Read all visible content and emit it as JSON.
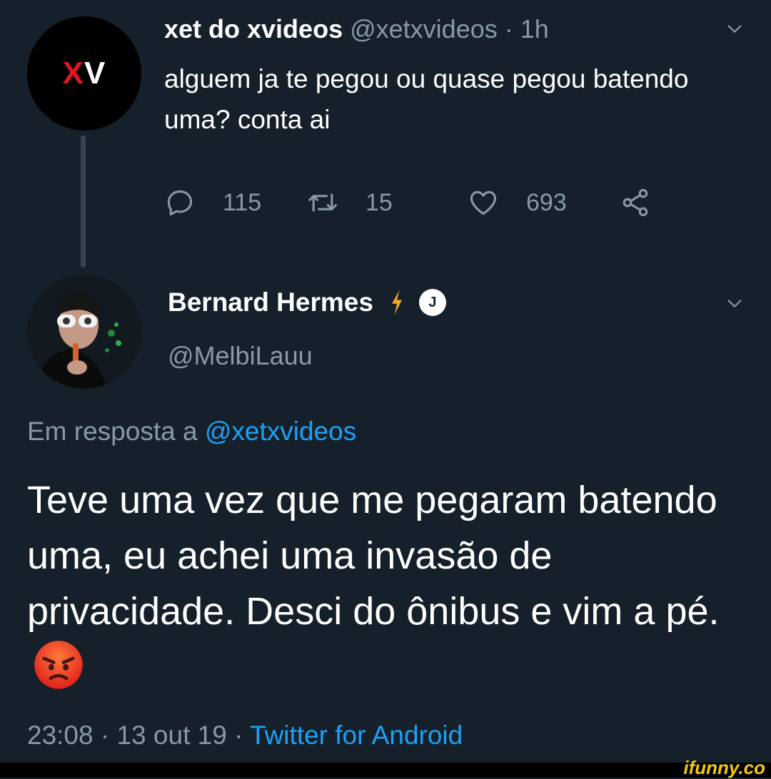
{
  "tweet1": {
    "avatar": {
      "letter_x": "X",
      "letter_v": "V",
      "x_color": "#e0161e"
    },
    "display_name": "xet do xvideos",
    "handle": "@xetxvideos",
    "separator": "·",
    "time": "1h",
    "text": "alguem ja te pegou ou quase pegou batendo uma? conta ai",
    "actions": {
      "reply_count": "115",
      "retweet_count": "15",
      "like_count": "693"
    }
  },
  "tweet2": {
    "display_name": "Bernard Hermes",
    "badge_letter": "J",
    "handle": "@MelbiLauu",
    "reply_prefix": "Em resposta a",
    "reply_target": "@xetxvideos",
    "text": "Teve uma vez que me pegaram batendo uma, eu achei uma invasão de privacidade. Desci do ônibus e vim a pé.",
    "meta_time": "23:08",
    "meta_sep1": "·",
    "meta_date": "13 out 19",
    "meta_sep2": "·",
    "meta_source": "Twitter for Android"
  },
  "watermark": "ifunny.co",
  "colors": {
    "background": "#15202b",
    "muted": "#8899a6",
    "link": "#1da1f2",
    "bolt": "#f5a623"
  },
  "icons": [
    "chevron-down-icon",
    "reply-icon",
    "retweet-icon",
    "like-icon",
    "share-icon",
    "lightning-icon",
    "angry-face-emoji"
  ]
}
